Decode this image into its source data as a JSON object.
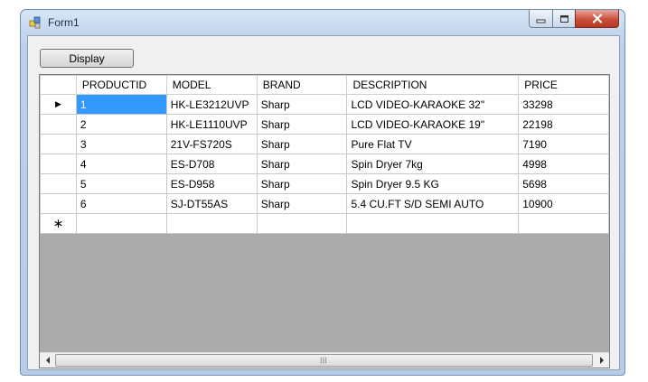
{
  "window": {
    "title": "Form1"
  },
  "toolbar": {
    "display_label": "Display"
  },
  "grid": {
    "columns": [
      "PRODUCTID",
      "MODEL",
      "BRAND",
      "DESCRIPTION",
      "PRICE"
    ],
    "rows": [
      [
        "1",
        "HK-LE3212UVP",
        "Sharp",
        "LCD VIDEO-KARAOKE 32\"",
        "33298"
      ],
      [
        "2",
        "HK-LE1110UVP",
        "Sharp",
        "LCD VIDEO-KARAOKE 19\"",
        "22198"
      ],
      [
        "3",
        "21V-FS720S",
        "Sharp",
        "Pure Flat TV",
        "7190"
      ],
      [
        "4",
        "ES-D708",
        "Sharp",
        "Spin Dryer 7kg",
        "4998"
      ],
      [
        "5",
        "ES-D958",
        "Sharp",
        "Spin Dryer 9.5 KG",
        "5698"
      ],
      [
        "6",
        "SJ-DT55AS",
        "Sharp",
        "5.4 CU.FT S/D SEMI AUTO",
        "10900"
      ]
    ],
    "current_row_glyph": "▶",
    "new_row_glyph": "∗",
    "selection_color": "#3399ff",
    "scroll_grip": "|||"
  },
  "icons": {
    "minimize": "minimize-icon",
    "maximize": "maximize-icon",
    "close": "close-icon",
    "scroll_left": "scroll-left-arrow-icon",
    "scroll_right": "scroll-right-arrow-icon"
  }
}
